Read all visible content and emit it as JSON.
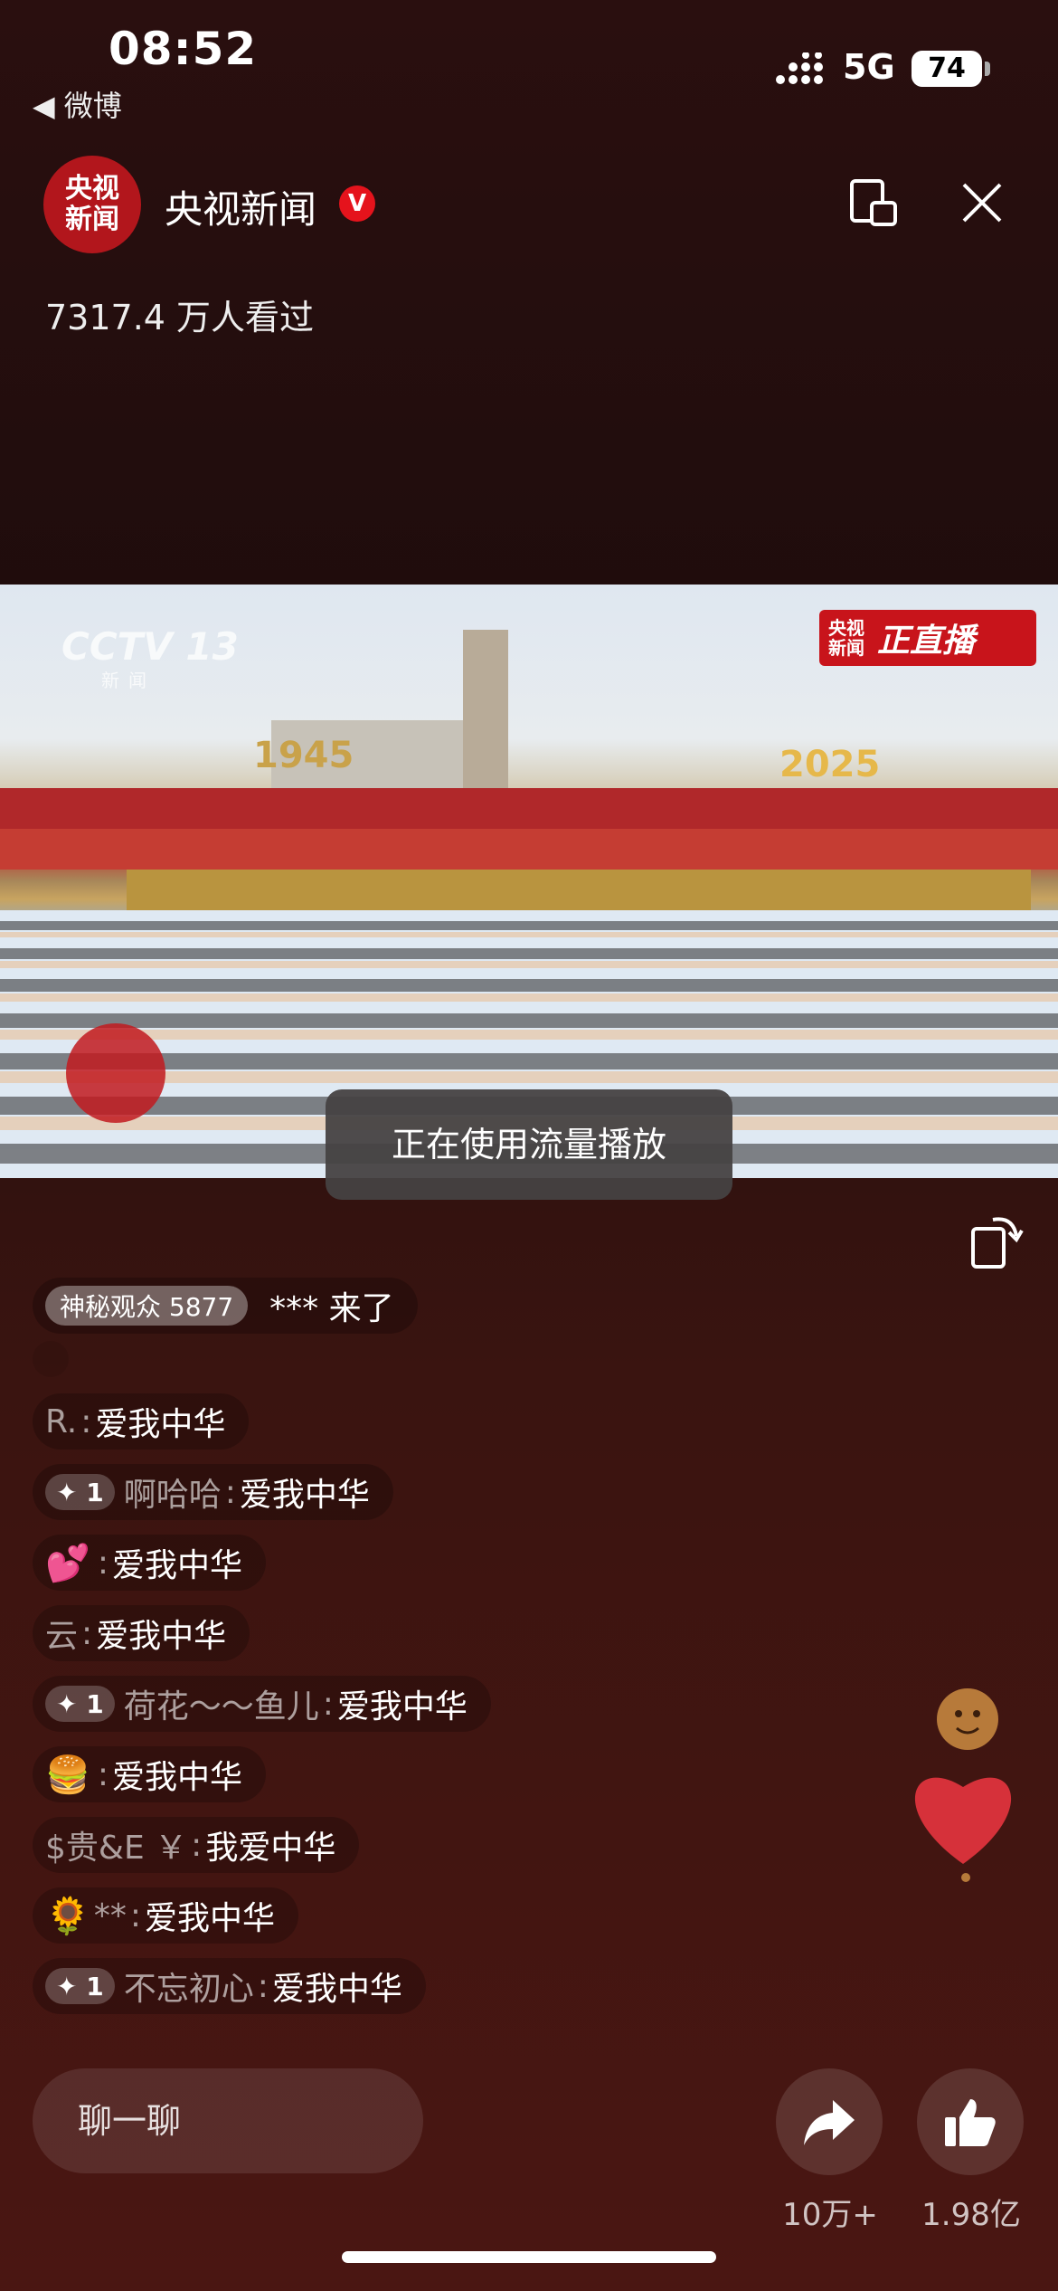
{
  "status_bar": {
    "time": "08:52",
    "back_app": "◀ 微博",
    "network": "5G",
    "battery": "74"
  },
  "header": {
    "avatar_text_1": "央视",
    "avatar_text_2": "新闻",
    "channel_name": "央视新闻",
    "verified_badge": "V",
    "viewers": "7317.4 万人看过"
  },
  "video": {
    "watermark": "CCTV 13",
    "watermark_sub": "新闻",
    "live_badge_small_1": "央视",
    "live_badge_small_2": "新闻",
    "live_badge_big": "正直播",
    "year_left": "1945",
    "year_right": "2025",
    "toast": "正在使用流量播放"
  },
  "comments": [
    {
      "type": "join",
      "badge": "神秘观众 5877",
      "text": "*** 来了"
    },
    {
      "name": "R.",
      "msg": "爱我中华"
    },
    {
      "level": "1",
      "name": "啊哈哈",
      "msg": "爱我中华"
    },
    {
      "emoji": "💕",
      "msg": "爱我中华"
    },
    {
      "name": "云",
      "msg": "爱我中华"
    },
    {
      "level": "1",
      "name": "荷花～～鱼儿",
      "msg": "爱我中华"
    },
    {
      "emoji": "🍔",
      "msg": "爱我中华"
    },
    {
      "name": "$贵&E ￥",
      "msg": "我爱中华"
    },
    {
      "emoji": "🌻",
      "name": "**",
      "msg": "爱我中华"
    },
    {
      "level": "1",
      "name": "不忘初心",
      "msg": "爱我中华"
    }
  ],
  "bottom": {
    "chat_placeholder": "聊一聊",
    "share_count": "10万+",
    "like_count": "1.98亿"
  },
  "icons": [
    "signal-icon",
    "pip-icon",
    "close-icon",
    "rotate-icon",
    "share-icon",
    "like-icon",
    "heart-sticker-icon"
  ]
}
